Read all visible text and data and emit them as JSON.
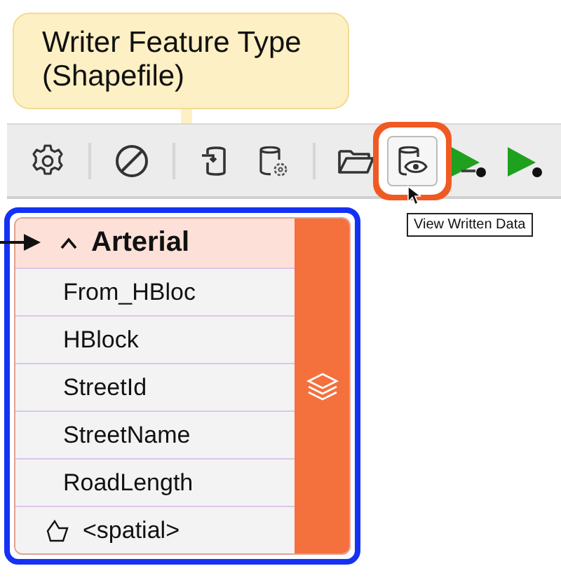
{
  "callout": {
    "text": "Writer Feature Type (Shapefile)"
  },
  "toolbar": {
    "buttons": [
      {
        "kind": "gear",
        "selected": false,
        "separator_after": true
      },
      {
        "kind": "prohibit",
        "selected": false,
        "separator_after": true
      },
      {
        "kind": "import",
        "selected": false,
        "separator_after": false
      },
      {
        "kind": "db-gear",
        "selected": false,
        "separator_after": true
      },
      {
        "kind": "folder",
        "selected": false,
        "separator_after": false
      },
      {
        "kind": "db-eye",
        "selected": true,
        "separator_after": false
      },
      {
        "kind": "run-to",
        "selected": false,
        "separator_after": false
      },
      {
        "kind": "run",
        "selected": false,
        "separator_after": false
      }
    ],
    "tooltip": "View Written Data"
  },
  "feature_type": {
    "name": "Arterial",
    "expanded": true,
    "selected": true,
    "attributes": [
      {
        "kind": "attribute",
        "name": "From_HBloc"
      },
      {
        "kind": "attribute",
        "name": "HBlock"
      },
      {
        "kind": "attribute",
        "name": "StreetId"
      },
      {
        "kind": "attribute",
        "name": "StreetName"
      },
      {
        "kind": "attribute",
        "name": "RoadLength"
      },
      {
        "kind": "spatial",
        "name": "<spatial>"
      }
    ]
  }
}
